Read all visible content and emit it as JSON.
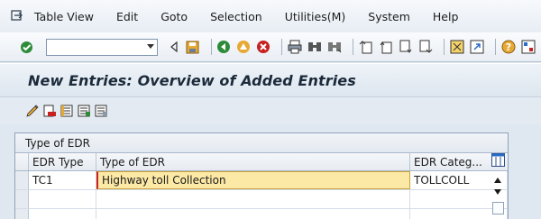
{
  "menubar": {
    "items": [
      "Table View",
      "Edit",
      "Goto",
      "Selection",
      "Utilities(M)",
      "System",
      "Help"
    ]
  },
  "toolbar": {
    "command_field_value": ""
  },
  "title": {
    "text": "New Entries: Overview of Added Entries"
  },
  "table": {
    "title": "Type of EDR",
    "columns": [
      "EDR Type",
      "Type of EDR",
      "EDR Categ..."
    ],
    "rows": [
      {
        "edr_type": "TC1",
        "type_of_edr": "Highway toll Collection",
        "edr_category": "TOLLCOLL"
      }
    ]
  },
  "colors": {
    "input_highlight": "#fde9a6",
    "title_text": "#1b2a3a",
    "frame": "#8ea2ba"
  }
}
